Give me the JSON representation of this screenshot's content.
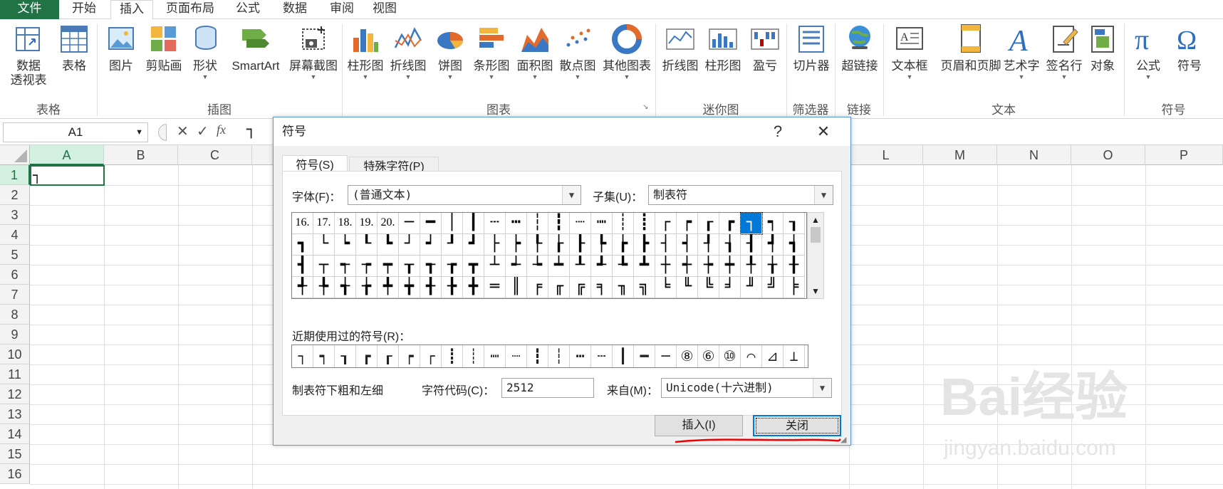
{
  "tabs": [
    "文件",
    "开始",
    "插入",
    "页面布局",
    "公式",
    "数据",
    "审阅",
    "视图"
  ],
  "ribbon": {
    "buttons": [
      "数据\n透视表",
      "表格",
      "图片",
      "剪贴画",
      "形状",
      "SmartArt",
      "屏幕截图",
      "柱形图",
      "折线图",
      "饼图",
      "条形图",
      "面积图",
      "散点图",
      "其他图表",
      "折线图",
      "柱形图",
      "盈亏",
      "切片器",
      "超链接",
      "文本框",
      "页眉和页脚",
      "艺术字",
      "签名行",
      "对象",
      "公式",
      "符号"
    ],
    "groups": [
      "表格",
      "插图",
      "图表",
      "迷你图",
      "筛选器",
      "链接",
      "文本",
      "符号"
    ]
  },
  "formula_bar": {
    "name_box": "A1",
    "content": "┐"
  },
  "sheet": {
    "columns": [
      "A",
      "B",
      "C",
      "L",
      "M",
      "N",
      "O",
      "P"
    ],
    "rows": [
      "1",
      "2",
      "3",
      "4",
      "5",
      "6",
      "7",
      "8",
      "9",
      "10",
      "11",
      "12",
      "13",
      "14",
      "15",
      "16"
    ],
    "a1_value": "┐"
  },
  "dialog": {
    "title": "符号",
    "help": "?",
    "close": "✕",
    "tabs": [
      "符号(S)",
      "特殊字符(P)"
    ],
    "font_label": "字体(F)：",
    "font_value": "(普通文本)",
    "subset_label": "子集(U)：",
    "subset_value": "制表符",
    "symbols": [
      "16.",
      "17.",
      "18.",
      "19.",
      "20.",
      "─",
      "━",
      "│",
      "┃",
      "┄",
      "┅",
      "┆",
      "┇",
      "┈",
      "┉",
      "┊",
      "┋",
      "┌",
      "┍",
      "┎",
      "┏",
      "┐",
      "┑",
      "┒",
      "┓",
      "└",
      "┕",
      "┖",
      "┗",
      "┘",
      "┙",
      "┚",
      "┛",
      "├",
      "┝",
      "┞",
      "┟",
      "┠",
      "┡",
      "┢",
      "┣",
      "┤",
      "┥",
      "┦",
      "┧",
      "┨",
      "┩",
      "┪",
      "┫",
      "┬",
      "┭",
      "┮",
      "┯",
      "┰",
      "┱",
      "┲",
      "┳",
      "┴",
      "┵",
      "┶",
      "┷",
      "┸",
      "┹",
      "┺",
      "┻",
      "┼",
      "┽",
      "┾",
      "┿",
      "╀",
      "╁",
      "╂",
      "╃",
      "╄",
      "╅",
      "╆",
      "╇",
      "╈",
      "╉",
      "╊",
      "╋",
      "═",
      "║",
      "╒",
      "╓",
      "╔",
      "╕",
      "╖",
      "╗",
      "╘",
      "╙",
      "╚",
      "╛",
      "╜",
      "╝",
      "╞"
    ],
    "recent_label": "近期使用过的符号(R)：",
    "recent": [
      "┐",
      "┑",
      "┒",
      "┏",
      "┎",
      "┍",
      "┌",
      "┋",
      "┊",
      "┉",
      "┈",
      "┇",
      "┆",
      "┅",
      "┄",
      "┃",
      "━",
      "─",
      "⑧",
      "⑥",
      "⑩",
      "⌒",
      "⊿",
      "⊥"
    ],
    "char_name": "制表符下粗和左细",
    "code_label": "字符代码(C)：",
    "code_value": "2512",
    "from_label": "来自(M)：",
    "from_value": "Unicode(十六进制)",
    "insert_label": "插入(I)",
    "close_label": "关闭"
  },
  "watermark": "Bai经验",
  "watermark_url": "jingyan.baidu.com"
}
